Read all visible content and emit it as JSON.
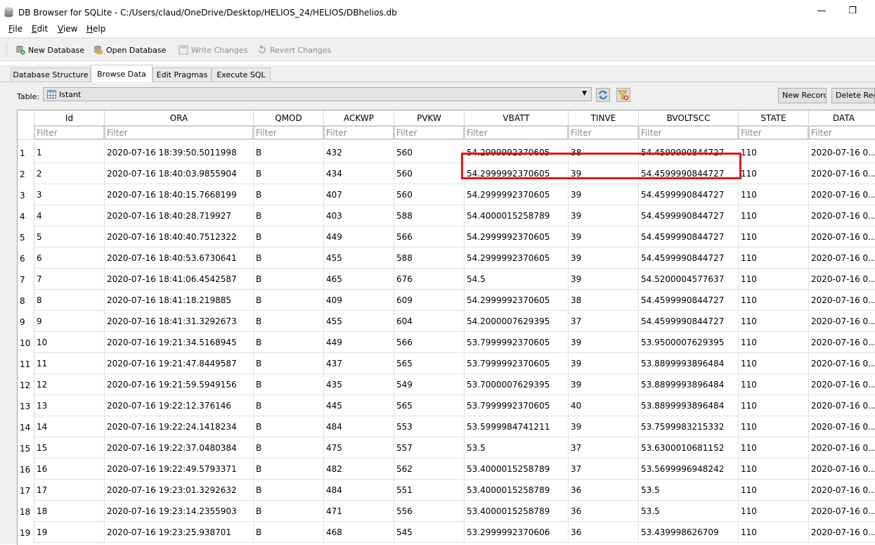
{
  "window": {
    "title": "DB Browser for SQLite - C:/Users/claud/OneDrive/Desktop/HELIOS_24/HELIOS/DBhelios.db",
    "minimize_glyph": "—",
    "restore_glyph": "❐"
  },
  "menu": [
    "File",
    "Edit",
    "View",
    "Help"
  ],
  "toolbar": {
    "new_database": "New Database",
    "open_database": "Open Database",
    "write_changes": "Write Changes",
    "revert_changes": "Revert Changes",
    "icons": [
      "new-database-icon",
      "open-database-icon",
      "write-changes-icon",
      "revert-changes-icon"
    ]
  },
  "tabs": [
    "Database Structure",
    "Browse Data",
    "Edit Pragmas",
    "Execute SQL"
  ],
  "active_tab": "Browse Data",
  "browse": {
    "table_label": "Table:",
    "table_name": "Istant",
    "new_record": "New Record",
    "delete_record": "Delete Record",
    "filter_placeholder": "Filter"
  },
  "colors": {
    "highlight": "#e0161f"
  },
  "grid": {
    "columns": [
      "Id",
      "ORA",
      "QMOD",
      "ACKWP",
      "PVKW",
      "VBATT",
      "TINVE",
      "BVOLTSCC",
      "STATE",
      "DATA"
    ],
    "rows": [
      [
        "1",
        "1",
        "2020-07-16 18:39:50.5011998",
        "B",
        "432",
        "560",
        "54.2999992370605",
        "38",
        "54.4599990844727",
        "110",
        "2020-07-16 0..."
      ],
      [
        "2",
        "2",
        "2020-07-16 18:40:03.9855904",
        "B",
        "434",
        "560",
        "54.2999992370605",
        "39",
        "54.4599990844727",
        "110",
        "2020-07-16 0..."
      ],
      [
        "3",
        "3",
        "2020-07-16 18:40:15.7668199",
        "B",
        "407",
        "560",
        "54.2999992370605",
        "39",
        "54.4599990844727",
        "110",
        "2020-07-16 0..."
      ],
      [
        "4",
        "4",
        "2020-07-16 18:40:28.719927",
        "B",
        "403",
        "588",
        "54.4000015258789",
        "39",
        "54.4599990844727",
        "110",
        "2020-07-16 0..."
      ],
      [
        "5",
        "5",
        "2020-07-16 18:40:40.7512322",
        "B",
        "449",
        "566",
        "54.2999992370605",
        "39",
        "54.4599990844727",
        "110",
        "2020-07-16 0..."
      ],
      [
        "6",
        "6",
        "2020-07-16 18:40:53.6730641",
        "B",
        "455",
        "588",
        "54.2999992370605",
        "39",
        "54.4599990844727",
        "110",
        "2020-07-16 0..."
      ],
      [
        "7",
        "7",
        "2020-07-16 18:41:06.4542587",
        "B",
        "465",
        "676",
        "54.5",
        "39",
        "54.5200004577637",
        "110",
        "2020-07-16 0..."
      ],
      [
        "8",
        "8",
        "2020-07-16 18:41:18.219885",
        "B",
        "409",
        "609",
        "54.2999992370605",
        "38",
        "54.4599990844727",
        "110",
        "2020-07-16 0..."
      ],
      [
        "9",
        "9",
        "2020-07-16 18:41:31.3292673",
        "B",
        "455",
        "604",
        "54.2000007629395",
        "37",
        "54.4599990844727",
        "110",
        "2020-07-16 0..."
      ],
      [
        "10",
        "10",
        "2020-07-16 19:21:34.5168945",
        "B",
        "449",
        "566",
        "53.7999992370605",
        "39",
        "53.9500007629395",
        "110",
        "2020-07-16 0..."
      ],
      [
        "11",
        "11",
        "2020-07-16 19:21:47.8449587",
        "B",
        "437",
        "565",
        "53.7999992370605",
        "39",
        "53.8899993896484",
        "110",
        "2020-07-16 0..."
      ],
      [
        "12",
        "12",
        "2020-07-16 19:21:59.5949156",
        "B",
        "435",
        "549",
        "53.7000007629395",
        "39",
        "53.8899993896484",
        "110",
        "2020-07-16 0..."
      ],
      [
        "13",
        "13",
        "2020-07-16 19:22:12.376146",
        "B",
        "445",
        "565",
        "53.7999992370605",
        "40",
        "53.8899993896484",
        "110",
        "2020-07-16 0..."
      ],
      [
        "14",
        "14",
        "2020-07-16 19:22:24.1418234",
        "B",
        "484",
        "553",
        "53.5999984741211",
        "39",
        "53.7599983215332",
        "110",
        "2020-07-16 0..."
      ],
      [
        "15",
        "15",
        "2020-07-16 19:22:37.0480384",
        "B",
        "475",
        "557",
        "53.5",
        "37",
        "53.6300010681152",
        "110",
        "2020-07-16 0..."
      ],
      [
        "16",
        "16",
        "2020-07-16 19:22:49.5793371",
        "B",
        "482",
        "562",
        "53.4000015258789",
        "37",
        "53.5699996948242",
        "110",
        "2020-07-16 0..."
      ],
      [
        "17",
        "17",
        "2020-07-16 19:23:01.3292632",
        "B",
        "484",
        "551",
        "53.4000015258789",
        "36",
        "53.5",
        "110",
        "2020-07-16 0..."
      ],
      [
        "18",
        "18",
        "2020-07-16 19:23:14.2355903",
        "B",
        "471",
        "556",
        "53.4000015258789",
        "36",
        "53.5",
        "110",
        "2020-07-16 0..."
      ],
      [
        "19",
        "19",
        "2020-07-16 19:23:25.938701",
        "B",
        "468",
        "545",
        "53.2999992370606",
        "36",
        "53.439998626709",
        "110",
        "2020-07-16 0..."
      ]
    ]
  }
}
